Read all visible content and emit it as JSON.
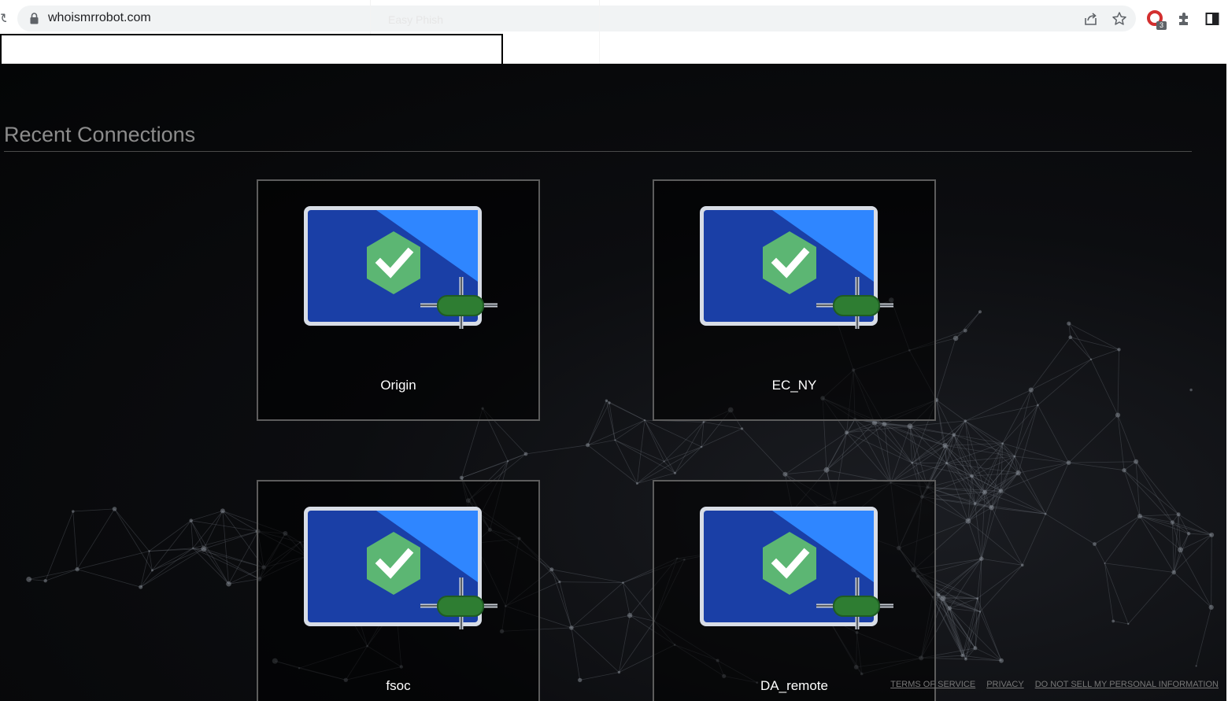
{
  "browser": {
    "url": "whoismrrobot.com",
    "ghost_tab_label": "Easy Phish",
    "extension_badge": "3"
  },
  "page_input": {
    "value": ""
  },
  "main": {
    "section_title": "Recent Connections",
    "connections": [
      {
        "name": "Origin",
        "status_icon": "check-hexagon-icon"
      },
      {
        "name": "EC_NY",
        "status_icon": "check-hexagon-icon"
      },
      {
        "name": "fsoc",
        "status_icon": "check-hexagon-icon"
      },
      {
        "name": "DA_remote",
        "status_icon": "check-hexagon-icon"
      }
    ]
  },
  "footer": {
    "links": [
      "TERMS OF SERVICE",
      "PRIVACY",
      "DO NOT SELL MY PERSONAL INFORMATION"
    ]
  },
  "colors": {
    "thumb_dark_blue": "#1a3fa6",
    "thumb_light_blue": "#2f86ff",
    "thumb_frame": "#d8dde6",
    "check_green": "#5cb673",
    "plug_green": "#2e7d32"
  }
}
